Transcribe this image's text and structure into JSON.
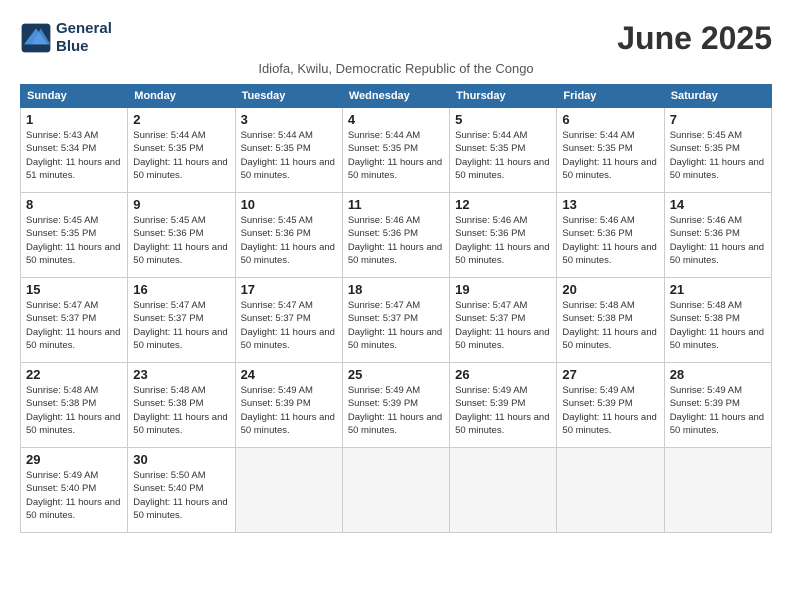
{
  "logo": {
    "line1": "General",
    "line2": "Blue"
  },
  "title": "June 2025",
  "subtitle": "Idiofa, Kwilu, Democratic Republic of the Congo",
  "days_of_week": [
    "Sunday",
    "Monday",
    "Tuesday",
    "Wednesday",
    "Thursday",
    "Friday",
    "Saturday"
  ],
  "weeks": [
    [
      {
        "day": 1,
        "sunrise": "5:43 AM",
        "sunset": "5:34 PM",
        "daylight": "11 hours and 51 minutes."
      },
      {
        "day": 2,
        "sunrise": "5:44 AM",
        "sunset": "5:35 PM",
        "daylight": "11 hours and 50 minutes."
      },
      {
        "day": 3,
        "sunrise": "5:44 AM",
        "sunset": "5:35 PM",
        "daylight": "11 hours and 50 minutes."
      },
      {
        "day": 4,
        "sunrise": "5:44 AM",
        "sunset": "5:35 PM",
        "daylight": "11 hours and 50 minutes."
      },
      {
        "day": 5,
        "sunrise": "5:44 AM",
        "sunset": "5:35 PM",
        "daylight": "11 hours and 50 minutes."
      },
      {
        "day": 6,
        "sunrise": "5:44 AM",
        "sunset": "5:35 PM",
        "daylight": "11 hours and 50 minutes."
      },
      {
        "day": 7,
        "sunrise": "5:45 AM",
        "sunset": "5:35 PM",
        "daylight": "11 hours and 50 minutes."
      }
    ],
    [
      {
        "day": 8,
        "sunrise": "5:45 AM",
        "sunset": "5:35 PM",
        "daylight": "11 hours and 50 minutes."
      },
      {
        "day": 9,
        "sunrise": "5:45 AM",
        "sunset": "5:36 PM",
        "daylight": "11 hours and 50 minutes."
      },
      {
        "day": 10,
        "sunrise": "5:45 AM",
        "sunset": "5:36 PM",
        "daylight": "11 hours and 50 minutes."
      },
      {
        "day": 11,
        "sunrise": "5:46 AM",
        "sunset": "5:36 PM",
        "daylight": "11 hours and 50 minutes."
      },
      {
        "day": 12,
        "sunrise": "5:46 AM",
        "sunset": "5:36 PM",
        "daylight": "11 hours and 50 minutes."
      },
      {
        "day": 13,
        "sunrise": "5:46 AM",
        "sunset": "5:36 PM",
        "daylight": "11 hours and 50 minutes."
      },
      {
        "day": 14,
        "sunrise": "5:46 AM",
        "sunset": "5:36 PM",
        "daylight": "11 hours and 50 minutes."
      }
    ],
    [
      {
        "day": 15,
        "sunrise": "5:47 AM",
        "sunset": "5:37 PM",
        "daylight": "11 hours and 50 minutes."
      },
      {
        "day": 16,
        "sunrise": "5:47 AM",
        "sunset": "5:37 PM",
        "daylight": "11 hours and 50 minutes."
      },
      {
        "day": 17,
        "sunrise": "5:47 AM",
        "sunset": "5:37 PM",
        "daylight": "11 hours and 50 minutes."
      },
      {
        "day": 18,
        "sunrise": "5:47 AM",
        "sunset": "5:37 PM",
        "daylight": "11 hours and 50 minutes."
      },
      {
        "day": 19,
        "sunrise": "5:47 AM",
        "sunset": "5:37 PM",
        "daylight": "11 hours and 50 minutes."
      },
      {
        "day": 20,
        "sunrise": "5:48 AM",
        "sunset": "5:38 PM",
        "daylight": "11 hours and 50 minutes."
      },
      {
        "day": 21,
        "sunrise": "5:48 AM",
        "sunset": "5:38 PM",
        "daylight": "11 hours and 50 minutes."
      }
    ],
    [
      {
        "day": 22,
        "sunrise": "5:48 AM",
        "sunset": "5:38 PM",
        "daylight": "11 hours and 50 minutes."
      },
      {
        "day": 23,
        "sunrise": "5:48 AM",
        "sunset": "5:38 PM",
        "daylight": "11 hours and 50 minutes."
      },
      {
        "day": 24,
        "sunrise": "5:49 AM",
        "sunset": "5:39 PM",
        "daylight": "11 hours and 50 minutes."
      },
      {
        "day": 25,
        "sunrise": "5:49 AM",
        "sunset": "5:39 PM",
        "daylight": "11 hours and 50 minutes."
      },
      {
        "day": 26,
        "sunrise": "5:49 AM",
        "sunset": "5:39 PM",
        "daylight": "11 hours and 50 minutes."
      },
      {
        "day": 27,
        "sunrise": "5:49 AM",
        "sunset": "5:39 PM",
        "daylight": "11 hours and 50 minutes."
      },
      {
        "day": 28,
        "sunrise": "5:49 AM",
        "sunset": "5:39 PM",
        "daylight": "11 hours and 50 minutes."
      }
    ],
    [
      {
        "day": 29,
        "sunrise": "5:49 AM",
        "sunset": "5:40 PM",
        "daylight": "11 hours and 50 minutes."
      },
      {
        "day": 30,
        "sunrise": "5:50 AM",
        "sunset": "5:40 PM",
        "daylight": "11 hours and 50 minutes."
      },
      null,
      null,
      null,
      null,
      null
    ]
  ]
}
